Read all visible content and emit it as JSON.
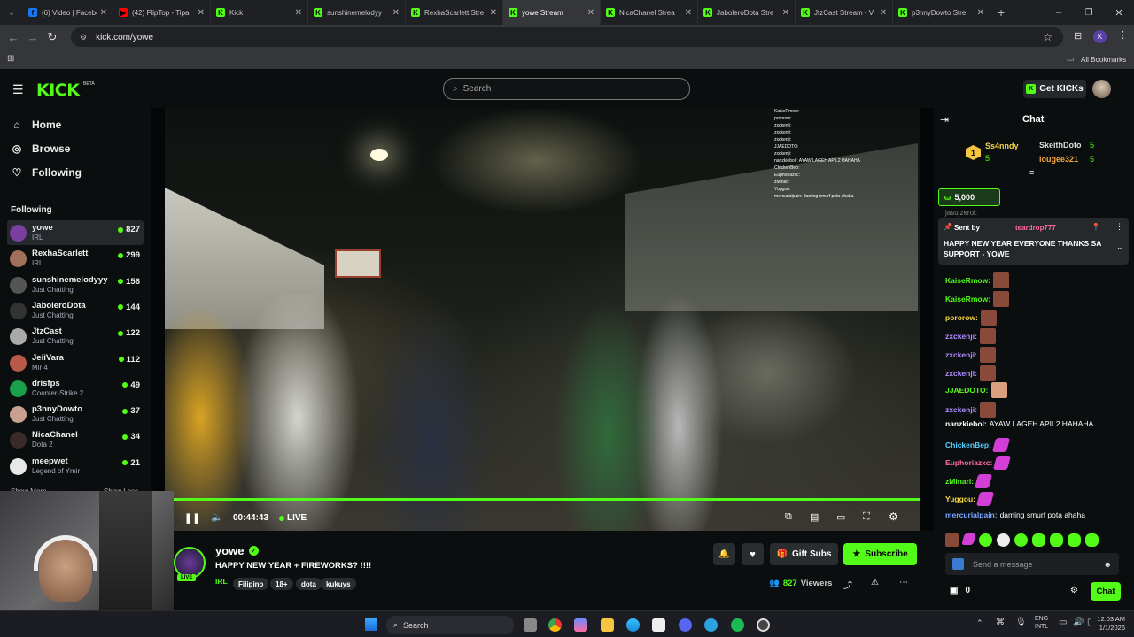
{
  "browser": {
    "tabs": [
      {
        "label": "(6) Video | Facebo",
        "color": "#1877f2",
        "glyph": "f"
      },
      {
        "label": "(42) FlipTop - Tipa",
        "color": "#ff0000",
        "glyph": "▶"
      },
      {
        "label": "Kick",
        "color": "#53fc18",
        "glyph": "K"
      },
      {
        "label": "sunshinemelodyy",
        "color": "#53fc18",
        "glyph": "K"
      },
      {
        "label": "RexhaScarlett Stre",
        "color": "#53fc18",
        "glyph": "K"
      },
      {
        "label": "yowe Stream",
        "color": "#53fc18",
        "glyph": "K",
        "active": true
      },
      {
        "label": "NicaChanel Strea",
        "color": "#53fc18",
        "glyph": "K"
      },
      {
        "label": "JaboleroDota Stre",
        "color": "#53fc18",
        "glyph": "K"
      },
      {
        "label": "JtzCast Stream - V",
        "color": "#53fc18",
        "glyph": "K"
      },
      {
        "label": "p3nnyDowto Stre",
        "color": "#53fc18",
        "glyph": "K"
      }
    ],
    "url": "kick.com/yowe",
    "all_bookmarks": "All Bookmarks",
    "profile_initial": "K"
  },
  "header": {
    "logo": "KICK",
    "beta": "BETA",
    "search_placeholder": "Search",
    "get_kicks": "Get KICKs"
  },
  "sidebar": {
    "nav": [
      {
        "label": "Home",
        "icon": "home-icon"
      },
      {
        "label": "Browse",
        "icon": "browse-icon"
      },
      {
        "label": "Following",
        "icon": "heart-icon"
      }
    ],
    "following_title": "Following",
    "channels": [
      {
        "name": "yowe",
        "category": "IRL",
        "viewers": "827",
        "color": "#7b3fa0"
      },
      {
        "name": "RexhaScarlett",
        "category": "IRL",
        "viewers": "299",
        "color": "#a0705a"
      },
      {
        "name": "sunshinemelodyyy",
        "category": "Just Chatting",
        "viewers": "156",
        "color": "#555"
      },
      {
        "name": "JaboleroDota",
        "category": "Just Chatting",
        "viewers": "144",
        "color": "#333"
      },
      {
        "name": "JtzCast",
        "category": "Just Chatting",
        "viewers": "122",
        "color": "#aaa"
      },
      {
        "name": "JeiiVara",
        "category": "Mir 4",
        "viewers": "112",
        "color": "#b85a4a"
      },
      {
        "name": "drisfps",
        "category": "Counter-Strike 2",
        "viewers": "49",
        "color": "#1aa04a"
      },
      {
        "name": "p3nnyDowto",
        "category": "Just Chatting",
        "viewers": "37",
        "color": "#c8a090"
      },
      {
        "name": "NicaChanel",
        "category": "Dota 2",
        "viewers": "34",
        "color": "#3a2a2a"
      },
      {
        "name": "meepwet",
        "category": "Legend of Ymir",
        "viewers": "21",
        "color": "#e8e8e8"
      }
    ],
    "show_more": "Show More",
    "show_less": "Show Less"
  },
  "player": {
    "time": "00:44:43",
    "live": "LIVE",
    "progress_fraction": 1.0
  },
  "stream": {
    "channel": "yowe",
    "title": "HAPPY NEW YEAR + FIREWORKS? !!!!",
    "live_badge": "LIVE",
    "category": "IRL",
    "tags": [
      "Filipino",
      "18+",
      "dota",
      "kukuys"
    ],
    "gift_subs": "Gift Subs",
    "subscribe": "Subscribe",
    "viewers": "827",
    "viewers_label": "Viewers"
  },
  "overlay_chat": [
    "KaiseRmow:",
    "pororow:",
    "zxckenji:",
    "zxckenji:",
    "zxckenji:",
    "JJAEDOTO:",
    "zxckenji:",
    "nanzkiebol : AYAW LAGEH APIL2 HAHAHA",
    "ChickenBep:",
    "Euphoriazxc:",
    "zMinari:",
    "Yuggou:",
    "mercurialpain: daming smurf pota ahaha"
  ],
  "chat": {
    "title": "Chat",
    "leaders": [
      {
        "rank": "1",
        "name": "Ss4nndy",
        "count": "5"
      },
      {
        "name": "SkeithDoto",
        "count": "5"
      },
      {
        "name": "lougee321",
        "count": "5"
      }
    ],
    "goal_amount": "5,000",
    "truncated_name": "jasujzeroi:",
    "pinned_sent_by": "Sent by",
    "pinned_user": "teardrop777",
    "pinned_message": "HAPPY NEW YEAR EVERYONE THANKS SA SUPPORT - YOWE",
    "messages": [
      {
        "user": "KaiseRmow:",
        "text": "",
        "color": "#53fc18",
        "emote": "face"
      },
      {
        "user": "KaiseRmow:",
        "text": "",
        "color": "#53fc18",
        "emote": "face"
      },
      {
        "user": "pororow:",
        "text": "",
        "color": "#f5d742",
        "emote": "face"
      },
      {
        "user": "zxckenji:",
        "text": "",
        "color": "#b38cff",
        "emote": "face"
      },
      {
        "user": "zxckenji:",
        "text": "",
        "color": "#b38cff",
        "emote": "face"
      },
      {
        "user": "zxckenji:",
        "text": "",
        "color": "#b38cff",
        "emote": "face"
      },
      {
        "user": "JJAEDOTO:",
        "text": "",
        "color": "#53fc18",
        "emote": "face2"
      },
      {
        "user": "zxckenji:",
        "text": "",
        "color": "#b38cff",
        "emote": "face"
      },
      {
        "user": "nanzkiebol:",
        "text": "AYAW LAGEH APIL2 HAHAHA",
        "color": "#ffffff",
        "emote": ""
      },
      {
        "user": "ChickenBep:",
        "text": "",
        "color": "#53d2ff",
        "emote": "pink"
      },
      {
        "user": "Euphoriazxc:",
        "text": "",
        "color": "#ff6aa0",
        "emote": "pink"
      },
      {
        "user": "zMinari:",
        "text": "",
        "color": "#53fc18",
        "emote": "pink"
      },
      {
        "user": "Yuggou:",
        "text": "",
        "color": "#f5d742",
        "emote": "pink"
      },
      {
        "user": "mercurialpain:",
        "text": "daming smurf pota ahaha",
        "color": "#7aa6ff",
        "emote": ""
      }
    ],
    "input_placeholder": "Send a message",
    "points": "0",
    "send_label": "Chat"
  },
  "taskbar": {
    "search": "Search",
    "lang": "ENG",
    "lang2": "INTL",
    "time": "12:03 AM",
    "date": "1/1/2026"
  }
}
